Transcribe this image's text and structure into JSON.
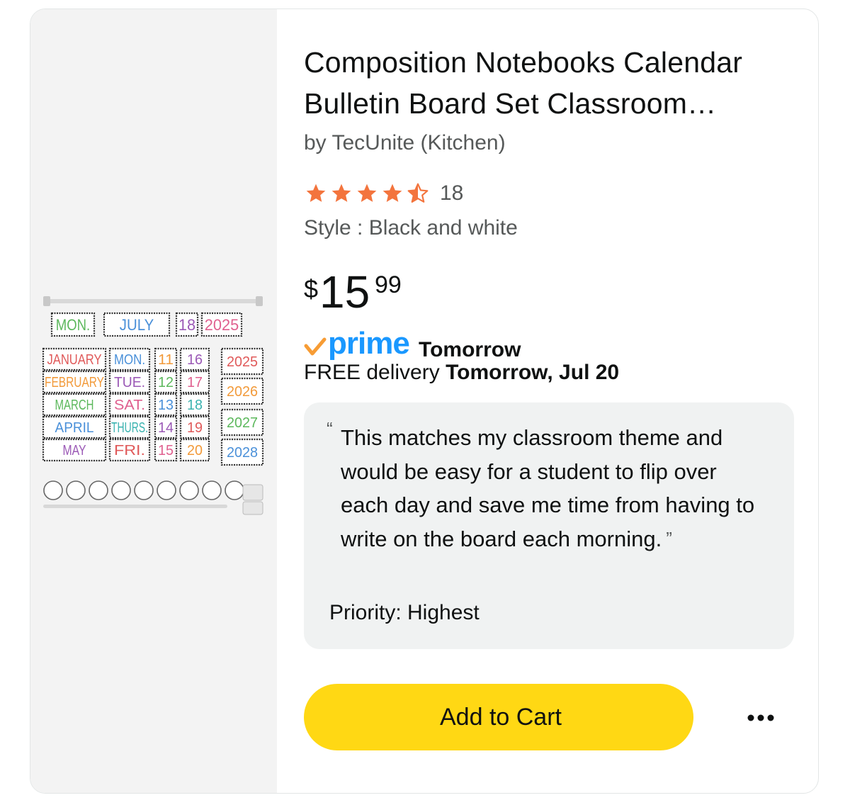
{
  "product": {
    "title": "Composition Notebooks Calendar Bulletin Board Set Classroom…",
    "brand": "by TecUnite (Kitchen)",
    "rating": 4.5,
    "rating_max": 5,
    "review_count": "18",
    "style": "Style : Black and white",
    "price": {
      "symbol": "$",
      "whole": "15",
      "fraction": "99"
    },
    "prime": {
      "logo_text": "prime",
      "speed": "Tomorrow",
      "check_icon": "prime-check-icon"
    },
    "delivery": {
      "prefix": "FREE delivery ",
      "date": "Tomorrow, Jul 20"
    }
  },
  "image": {
    "top_row": [
      "MON.",
      "JULY",
      "18",
      "2025"
    ],
    "months": [
      "JANUARY",
      "FEBRUARY",
      "MARCH",
      "APRIL",
      "MAY"
    ],
    "days": [
      "MON.",
      "TUE.",
      "SAT.",
      "THURS.",
      "FRI."
    ],
    "nums_a": [
      "11",
      "12",
      "13",
      "14",
      "15"
    ],
    "nums_b": [
      "16",
      "17",
      "18",
      "19",
      "20"
    ],
    "years": [
      "2025",
      "2026",
      "2027",
      "2028"
    ]
  },
  "note": {
    "open_quote": "“",
    "text": "This matches my classroom theme and would be easy for a student to flip over each day and save me time from having to write on the board each morning.",
    "close_quote": "”",
    "priority": "Priority: Highest"
  },
  "actions": {
    "add_to_cart": "Add to Cart",
    "more_icon": "more-options-icon"
  },
  "colors": {
    "star": "#f3743d",
    "prime_blue": "#1a98ff",
    "prime_check": "#f79c34",
    "cart_button": "#ffd814",
    "note_bg": "#f0f2f2"
  }
}
